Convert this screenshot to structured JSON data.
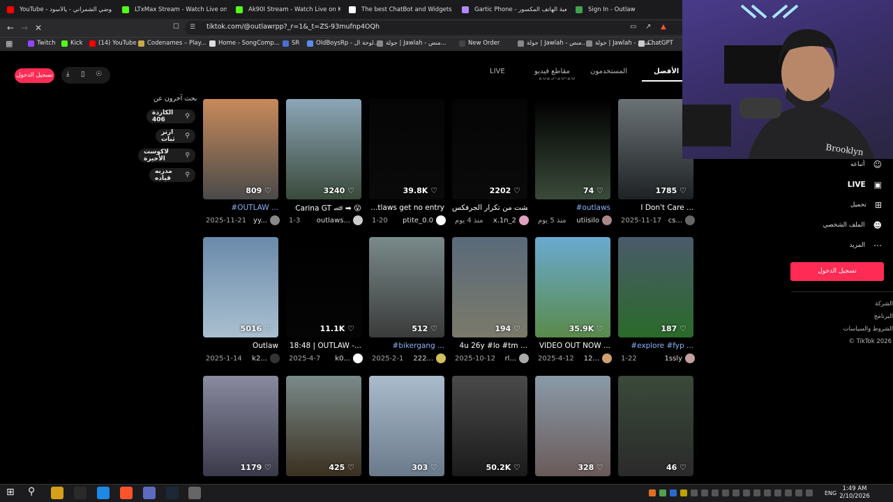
{
  "browser": {
    "tabs": [
      {
        "label": "YouTube - موضي الشمراني - يالأسود",
        "color": "#ff0000"
      },
      {
        "label": "LTxMax Stream - Watch Live on K",
        "color": "#53fc18"
      },
      {
        "label": "Ak90I Stream - Watch Live on Ki",
        "color": "#53fc18"
      },
      {
        "label": "The best ChatBot and Widgets for K",
        "color": "#ffffff"
      },
      {
        "label": "Gartic Phone - لعبة الهاتف المكسور",
        "color": "#b388ff"
      },
      {
        "label": "Sign In - Outlaw",
        "color": "#3fa34d"
      }
    ],
    "url": "tiktok.com/@outlawrpp?_r=1&_t=ZS-93mufnp4OQh",
    "bookmarks": [
      {
        "label": "Twitch",
        "color": "#9146ff"
      },
      {
        "label": "Kick",
        "color": "#53fc18"
      },
      {
        "label": "(14) YouTube",
        "color": "#ff0000"
      },
      {
        "label": "Codenames – Play...",
        "color": "#c9a94b"
      },
      {
        "label": "Home - SongComp...",
        "color": "#dddddd"
      },
      {
        "label": "SR",
        "color": "#4a6fd1"
      },
      {
        "label": "OldBoysRp - لوحة ال...",
        "color": "#5b8def"
      },
      {
        "label": "جولة | Jawlah - منص...",
        "color": "#888888"
      },
      {
        "label": "New Order",
        "color": "#444444"
      },
      {
        "label": "جولة | Jawlah - منص...",
        "color": "#888888"
      },
      {
        "label": "جولة | Jawlah - منص...",
        "color": "#888888"
      },
      {
        "label": "ChatGPT",
        "color": "#cccccc"
      }
    ]
  },
  "tiktok": {
    "top_tabs": {
      "best": "الأفضل",
      "users": "المستخدمون",
      "videos": "مقاطع فيديو",
      "live": "LIVE"
    },
    "top_partial": "2025-10-28",
    "login_small": "تسجيل الدخول",
    "others_title": "بحث آخرون عن",
    "others": [
      "الكاردة 406",
      "ارنر ثبات",
      "لاكوست الأخيرة",
      "مدربه قياده"
    ],
    "sidebar": {
      "friends": "أتباعه",
      "live": "LIVE",
      "upload": "تحميل",
      "profile": "الملف الشخصي",
      "more": "المزيد",
      "login": "تسجيل الدخول",
      "footer": [
        "الشركة",
        "البرنامج",
        "الشروط والسياسات",
        "© TikTok 2026"
      ]
    },
    "videos": [
      {
        "likes": "1785",
        "title": "I Don't Care ...",
        "user": "cs...",
        "date": "2025-11-17",
        "tag": false,
        "c1": "#6b7276",
        "c2": "#1e2224",
        "avc": "#666666"
      },
      {
        "likes": "74",
        "title": "#outlaws",
        "user": "utiisilo",
        "date": "منذ 5 يوم",
        "tag": true,
        "c1": "#000000",
        "c2": "#3a4a3a",
        "avc": "#aa8888"
      },
      {
        "likes": "2202",
        "title": "طفشت من تكرار الجرفكس...",
        "user": "x.1n_2",
        "date": "منذ 4 يوم",
        "tag": false,
        "c1": "#050505",
        "c2": "#0a0a0a",
        "avc": "#e0a0c0"
      },
      {
        "likes": "39.8K",
        "title": "...tlaws get no entry",
        "user": "ptite_0.0",
        "date": "1-20",
        "tag": false,
        "c1": "#050505",
        "c2": "#0a0a0a",
        "avc": "#ffffff"
      },
      {
        "likes": "3240",
        "title": "Carina GT 🏎 ➡ 😮",
        "user": "outlaws...",
        "date": "1-3",
        "tag": false,
        "c1": "#8ba6b8",
        "c2": "#3a4a3a",
        "avc": "#cccccc"
      },
      {
        "likes": "809",
        "title": "#OUTLAW ...",
        "user": "yy...",
        "date": "2025-11-21",
        "tag": true,
        "c1": "#c88a5a",
        "c2": "#4a4a4a",
        "avc": "#888888"
      },
      {
        "likes": "187",
        "title": "#explore #fyp ...",
        "user": "1ssly",
        "date": "1-22",
        "tag": true,
        "c1": "#4a5a6a",
        "c2": "#2a6a2a",
        "avc": "#c0a0a0"
      },
      {
        "likes": "35.9K",
        "title": "VIDEO OUT NOW ...",
        "user": "12...",
        "date": "2025-4-12",
        "tag": false,
        "c1": "#6aaad0",
        "c2": "#5a8a4a",
        "avc": "#d0a070"
      },
      {
        "likes": "194",
        "title": "4u 26y #lo #tm ...",
        "user": "rl...",
        "date": "2025-10-12",
        "tag": false,
        "c1": "#5a6a7a",
        "c2": "#7a7a6a",
        "avc": "#aaaaaa"
      },
      {
        "likes": "512",
        "title": "#bikergang ...",
        "user": "222...",
        "date": "2025-2-1",
        "tag": true,
        "c1": "#7a8a8a",
        "c2": "#3a3a3a",
        "avc": "#d0c060"
      },
      {
        "likes": "11.1K",
        "title": "18:48 | OUTLAW -...",
        "user": "k0...",
        "date": "2025-4-7",
        "tag": false,
        "c1": "#000000",
        "c2": "#050505",
        "avc": "#ffffff"
      },
      {
        "likes": "5016",
        "title": "Outlaw",
        "user": "k2...",
        "date": "2025-1-14",
        "tag": false,
        "c1": "#6a8aaa",
        "c2": "#aac0d0",
        "avc": "#333333"
      },
      {
        "likes": "46",
        "title": "",
        "user": "",
        "date": "",
        "tag": false,
        "c1": "#3a4a3a",
        "c2": "#2a2a2a",
        "avc": "#555555"
      },
      {
        "likes": "328",
        "title": "",
        "user": "",
        "date": "",
        "tag": false,
        "c1": "#8a9aa8",
        "c2": "#6a5a5a",
        "avc": "#555555"
      },
      {
        "likes": "50.2K",
        "title": "",
        "user": "",
        "date": "",
        "tag": false,
        "c1": "#4a4a4a",
        "c2": "#1a1a1a",
        "avc": "#555555"
      },
      {
        "likes": "303",
        "title": "",
        "user": "",
        "date": "",
        "tag": false,
        "c1": "#aabbcc",
        "c2": "#6a7a8a",
        "avc": "#555555"
      },
      {
        "likes": "425",
        "title": "",
        "user": "",
        "date": "",
        "tag": false,
        "c1": "#7a8a8a",
        "c2": "#3a3020",
        "avc": "#555555"
      },
      {
        "likes": "1179",
        "title": "",
        "user": "",
        "date": "",
        "tag": false,
        "c1": "#8a8aa0",
        "c2": "#3a3a4a",
        "avc": "#555555"
      }
    ]
  },
  "webcam": {
    "sign": "Brooklyn"
  },
  "taskbar": {
    "lang": "ENG",
    "time": "1:49 AM",
    "date": "2/10/2026"
  }
}
